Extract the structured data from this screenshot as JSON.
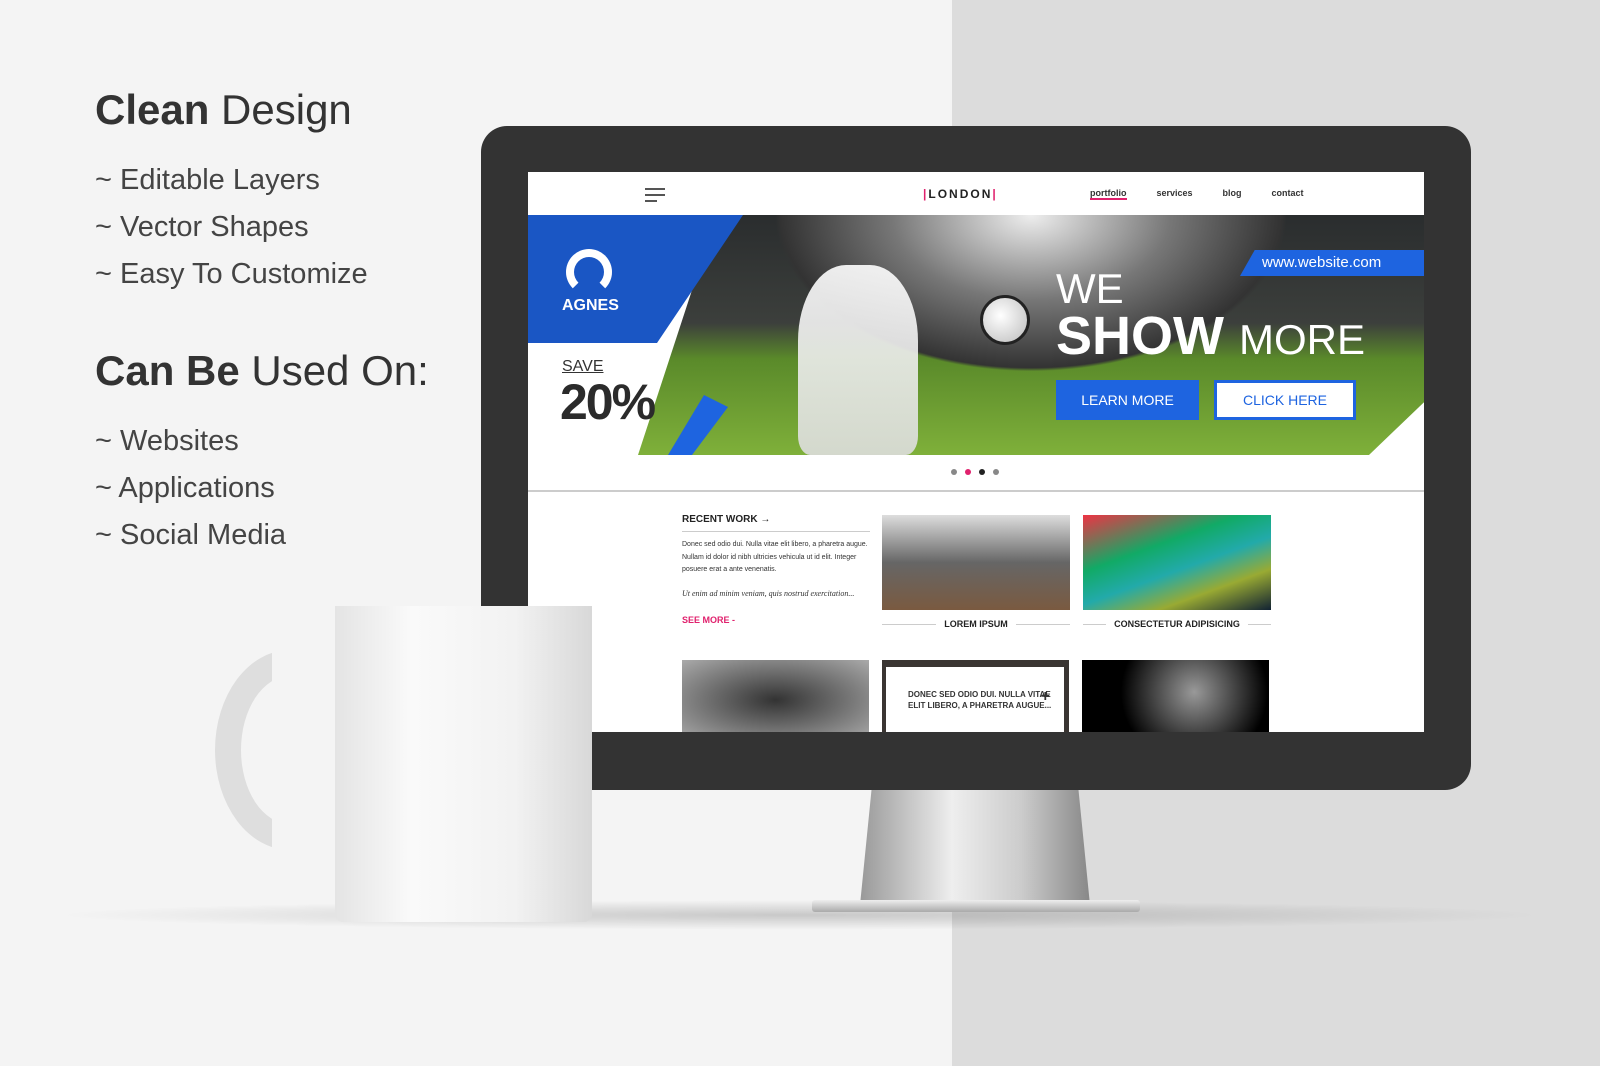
{
  "promo": {
    "title_bold": "Clean",
    "title_rest": " Design",
    "features": [
      "~ Editable Layers",
      "~ Vector Shapes",
      "~ Easy To Customize"
    ],
    "usage_bold": "Can Be",
    "usage_rest": " Used On:",
    "uses": [
      "~ Websites",
      "~ Applications",
      "~ Social Media"
    ]
  },
  "site": {
    "logo": "LONDON",
    "nav": [
      "portfolio",
      "services",
      "blog",
      "contact"
    ],
    "hero": {
      "brand": "AGNES",
      "save": "SAVE",
      "percent": "20%",
      "url": "www.website.com",
      "line1": "WE",
      "line2_bold": "SHOW",
      "line2_rest": "MORE",
      "learn_more": "LEARN MORE",
      "click_here": "CLICK HERE",
      "active_dot": 3,
      "dot_colors": {
        "accent": "#e0216d",
        "brand": "#1e64e0"
      }
    },
    "recent": {
      "title": "RECENT WORK →",
      "para": "Donec sed odio dui. Nulla vitae elit libero, a pharetra augue. Nullam id dolor id nibh ultricies vehicula ut id elit. Integer posuere erat a ante venenatis.",
      "italic": "Ut enim ad minim veniam, quis nostrud exercitation...",
      "see_more": "SEE MORE -"
    },
    "captions": [
      "LOREM IPSUM",
      "CONSECTETUR ADIPISICING"
    ],
    "overlay_text": "DONEC SED ODIO DUI. NULLA VITAE ELIT LIBERO, A PHARETRA AUGUE...",
    "overlay_plus": "+"
  }
}
